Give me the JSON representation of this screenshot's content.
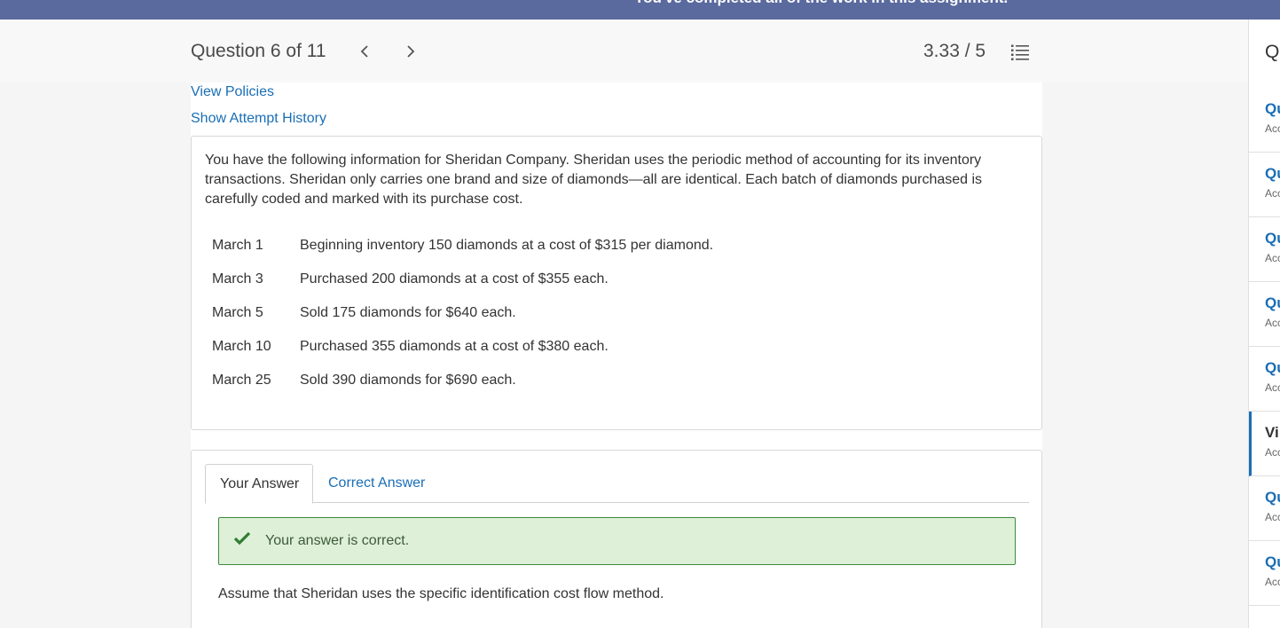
{
  "banner": {
    "text": "You've completed all of the work in this assignment."
  },
  "header": {
    "question_label": "Question 6 of 11",
    "score": "3.33 / 5"
  },
  "links": {
    "view_policies": "View Policies",
    "show_attempt_history": "Show Attempt History"
  },
  "question": {
    "intro": "You have the following information for Sheridan Company. Sheridan uses the periodic method of accounting for its inventory transactions. Sheridan only carries one brand and size of diamonds—all are identical. Each batch of diamonds purchased is carefully coded and marked with its purchase cost.",
    "transactions": [
      {
        "date": "March 1",
        "desc": "Beginning inventory 150 diamonds at a cost of $315 per diamond."
      },
      {
        "date": "March 3",
        "desc": "Purchased 200 diamonds at a cost of $355 each."
      },
      {
        "date": "March 5",
        "desc": "Sold 175 diamonds for $640 each."
      },
      {
        "date": "March 10",
        "desc": "Purchased 355 diamonds at a cost of $380 each."
      },
      {
        "date": "March 25",
        "desc": "Sold 390 diamonds for $690 each."
      }
    ]
  },
  "answer": {
    "tabs": [
      {
        "label": "Your Answer"
      },
      {
        "label": "Correct Answer"
      }
    ],
    "feedback": "Your answer is correct.",
    "assumption": "Assume that Sheridan uses the specific identification cost flow method."
  },
  "right_panel": {
    "header": "Qu",
    "items": [
      {
        "title": "Qu",
        "sub": "Acc"
      },
      {
        "title": "Qu",
        "sub": "Acc"
      },
      {
        "title": "Qu",
        "sub": "Acc"
      },
      {
        "title": "Qu",
        "sub": "Acc"
      },
      {
        "title": "Qu",
        "sub": "Acc"
      },
      {
        "title": "Vi",
        "sub": "Acc"
      },
      {
        "title": "Qu",
        "sub": "Acc"
      },
      {
        "title": "Qu",
        "sub": "Acc"
      }
    ]
  },
  "colors": {
    "banner": "#5a6a9e",
    "link": "#1a6eb5",
    "success_bg": "#dff0d8",
    "success_border": "#3c8a3c"
  }
}
